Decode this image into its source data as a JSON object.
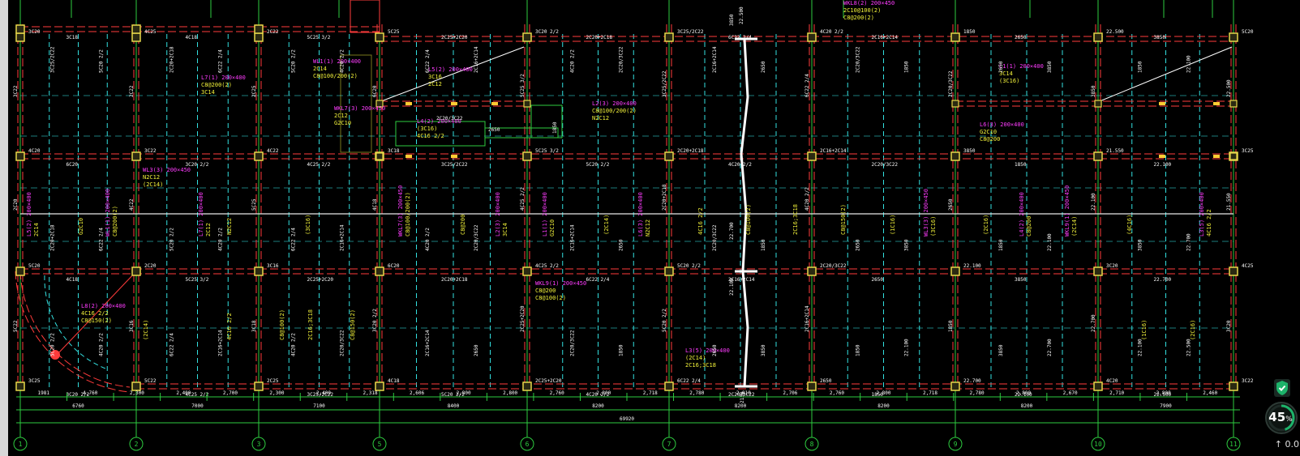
{
  "colors": {
    "background": "#000000",
    "wall_line": "#ff3b3b",
    "beam_line": "#33e0e0",
    "column": "#e8d84a",
    "axis_line": "#2ecc40",
    "note_magenta": "#ff3cff",
    "note_yellow": "#f2f23a",
    "text_white": "#ffffff",
    "widget_green": "#1db36a"
  },
  "axes": {
    "labels": [
      "1",
      "2",
      "3",
      "5",
      "6",
      "7",
      "8",
      "9",
      "10",
      "11"
    ]
  },
  "dimensions": {
    "row1": [
      "1981",
      "4,760",
      "2,300",
      "2,400",
      "2,700",
      "2,300",
      "2,400",
      "2,318",
      "2,606",
      "2,800",
      "2,800",
      "2,760",
      "2,800",
      "2,718",
      "2,780",
      "2,810",
      "2,706",
      "2,760",
      "2,800",
      "2,718",
      "2,780",
      "2,800",
      "2,670",
      "2,710",
      "2,800",
      "2,460"
    ],
    "row2": [
      "6760",
      "7000",
      "7100",
      "8400",
      "8200",
      "8200",
      "8200",
      "8200",
      "7900"
    ],
    "total": "69920",
    "column_mark": "2150"
  },
  "labels": {
    "magenta": [
      "WKL8(2) 200×450",
      "L5(2) 200×400",
      "WL1(1) 200×400",
      "L7(1) 200×400",
      "WKL7(3) 200×450",
      "L2(3) 200×400",
      "L1(1) 200×400",
      "L6(3) 200×400",
      "WL3(3) 200×450",
      "L4(2) 200×400",
      "WKL9(1) 200×450",
      "L3(5) 200×400",
      "L8(2) 200×400"
    ],
    "yellow": [
      "2C10@100(2)",
      "3C16",
      "2C14",
      "C8@200(2)",
      "2C12",
      "C8@100/200(2)",
      "3C14",
      "G2C10",
      "N2C12",
      "(3C16)",
      "C8@200",
      "(2C14)",
      "4C16 2/2",
      "C8@100(2)",
      "2C16;3C18",
      "C8@150(2)",
      "(1C16)",
      "(2C16)",
      "(4C16)"
    ],
    "white": [
      "3C20",
      "4C20",
      "5C20",
      "3C25",
      "4C25",
      "3C22",
      "2C20",
      "5C22",
      "2C22",
      "4C22",
      "3C16",
      "2C25",
      "5C25",
      "3C18",
      "6C20",
      "4C18",
      "3C20 2/2",
      "5C25 3/2",
      "4C25 2/2",
      "2C25+2C20",
      "3C25/2C22",
      "2C20+2C18",
      "5C20 2/2",
      "6C22 2/4",
      "4C20 2/2",
      "2C16+2C14",
      "2C20/3C22",
      "2650",
      "1850",
      "3850",
      "22.100",
      "22.700",
      "22.500",
      "21.550"
    ]
  },
  "widget": {
    "percent": "45",
    "percent_unit": "%",
    "speed": "0.0"
  }
}
